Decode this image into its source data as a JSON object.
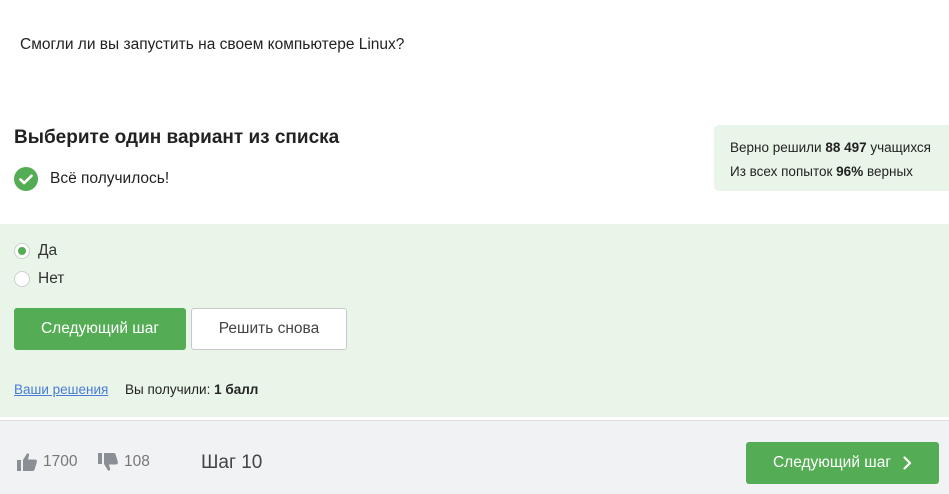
{
  "question": "Смогли ли вы запустить на своем компьютере Linux?",
  "choose_title": "Выберите один вариант из списка",
  "result": {
    "message": "Всё получилось!",
    "icon": "check-icon"
  },
  "stats": {
    "solved_prefix": "Верно решили",
    "solved_count": "88 497",
    "solved_suffix": "учащихся",
    "attempts_prefix": "Из всех попыток",
    "attempts_percent": "96%",
    "attempts_suffix": "верных"
  },
  "options": [
    {
      "label": "Да",
      "selected": true
    },
    {
      "label": "Нет",
      "selected": false
    }
  ],
  "buttons": {
    "next_step": "Следующий шаг",
    "retry": "Решить снова"
  },
  "solutions_link": "Ваши решения",
  "score": {
    "prefix": "Вы получили:",
    "value": "1 балл"
  },
  "footer": {
    "likes": "1700",
    "dislikes": "108",
    "step": "Шаг 10",
    "next_label": "Следующий шаг"
  },
  "colors": {
    "accent": "#54ad54",
    "answer_bg": "#e9f5e9",
    "link": "#4a7bd6",
    "footer_bg": "#f1f2f4"
  }
}
